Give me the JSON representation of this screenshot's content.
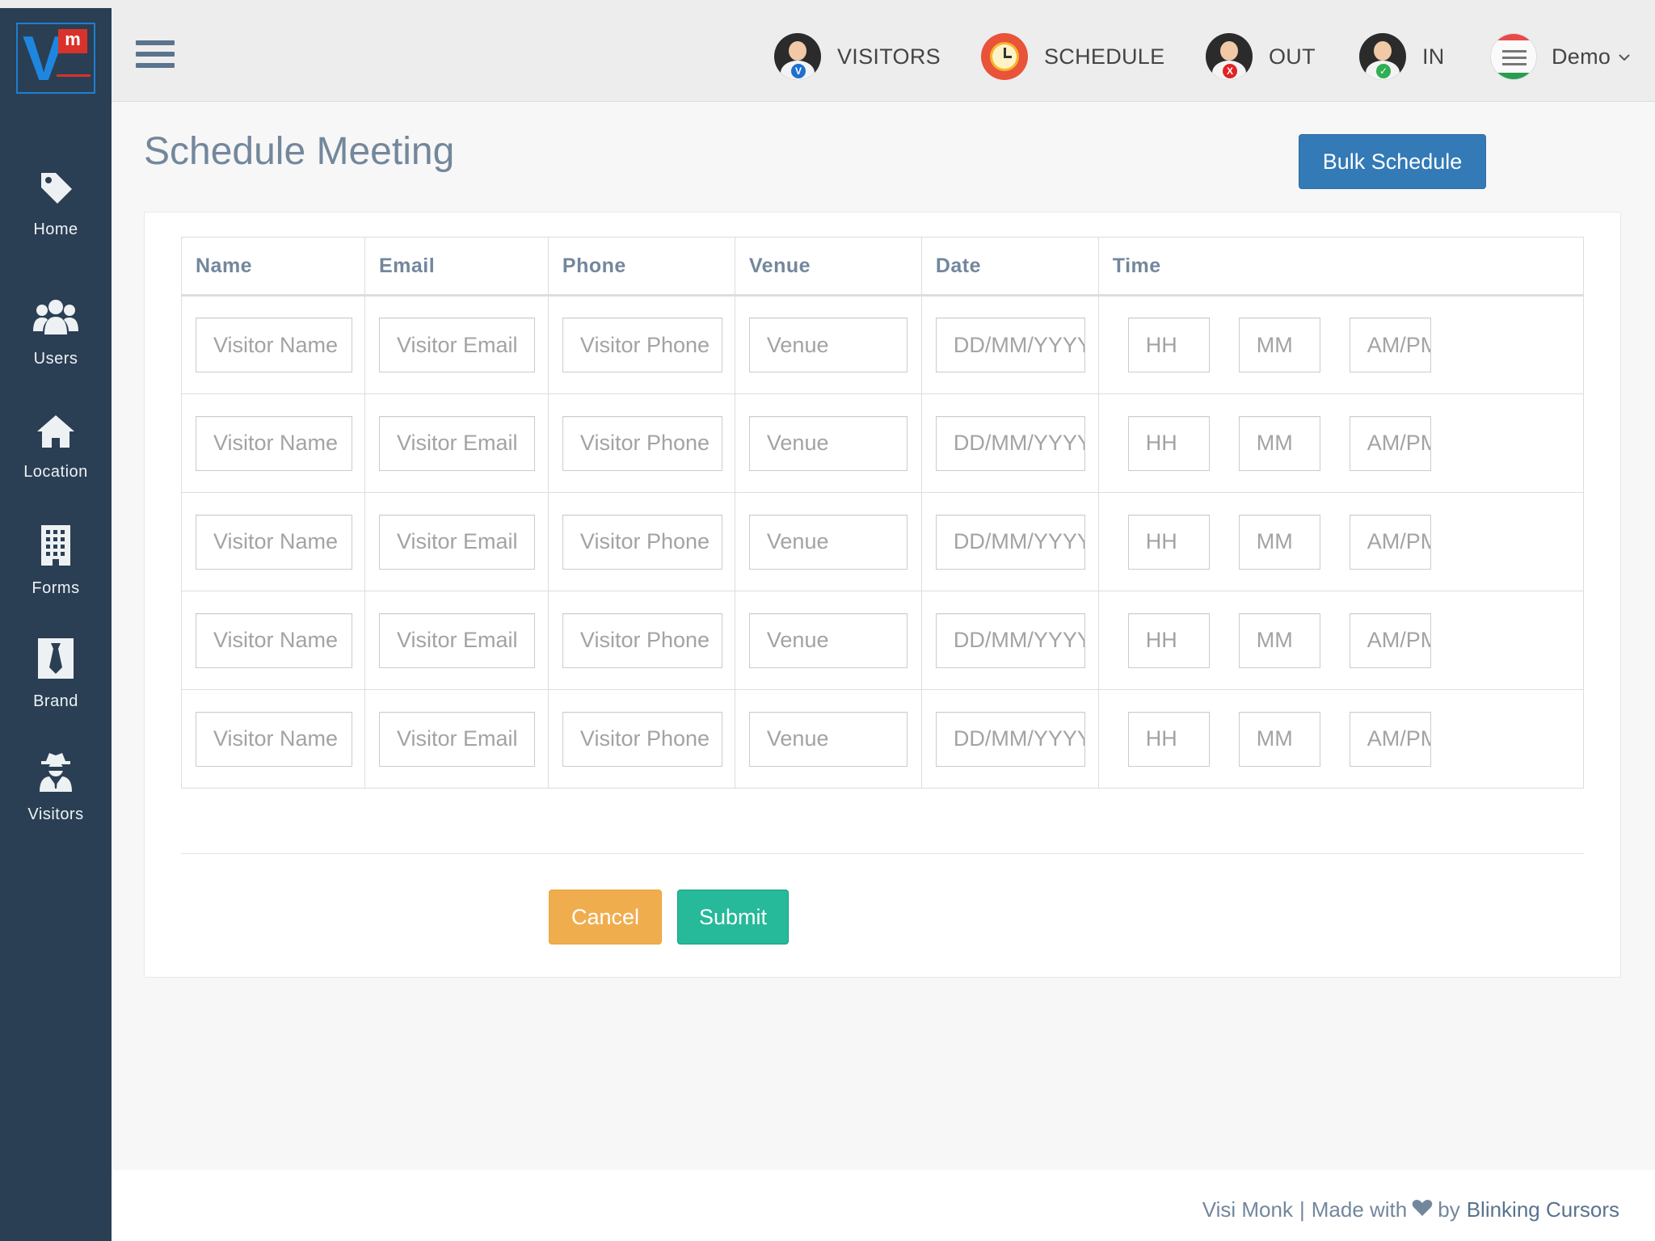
{
  "app": {
    "logo_text_v": "V",
    "logo_text_m": "m"
  },
  "sidebar": {
    "items": [
      {
        "label": "Home",
        "icon": "tag-icon"
      },
      {
        "label": "Users",
        "icon": "users-icon"
      },
      {
        "label": "Location",
        "icon": "home-icon"
      },
      {
        "label": "Forms",
        "icon": "building-icon"
      },
      {
        "label": "Brand",
        "icon": "tie-icon"
      },
      {
        "label": "Visitors",
        "icon": "user-secret-icon"
      }
    ]
  },
  "header": {
    "nav": [
      {
        "label": "VISITORS",
        "badge": "V",
        "badge_color": "#1e6fd0"
      },
      {
        "label": "SCHEDULE"
      },
      {
        "label": "OUT",
        "badge": "X",
        "badge_color": "#e02424"
      },
      {
        "label": "IN",
        "badge": "✓",
        "badge_color": "#2fae52"
      }
    ],
    "user": "Demo"
  },
  "page": {
    "title": "Schedule Meeting",
    "bulk_button": "Bulk Schedule"
  },
  "table": {
    "headers": [
      "Name",
      "Email",
      "Phone",
      "Venue",
      "Date",
      "Time"
    ],
    "placeholders": {
      "name": "Visitor Name",
      "email": "Visitor Email",
      "phone": "Visitor Phone",
      "venue": "Venue",
      "date": "DD/MM/YYYY",
      "hour": "HH",
      "minute": "MM",
      "ampm": "AM/PM"
    },
    "row_count": 5
  },
  "actions": {
    "cancel": "Cancel",
    "submit": "Submit"
  },
  "footer": {
    "brand": "Visi Monk",
    "separator": "|",
    "made_with": "Made with",
    "by": "by",
    "company": "Blinking Cursors"
  },
  "colors": {
    "sidebar": "#2a3f54",
    "primary": "#337ab7",
    "cancel": "#f0ad4e",
    "submit": "#26b99a",
    "title": "#73879c"
  }
}
